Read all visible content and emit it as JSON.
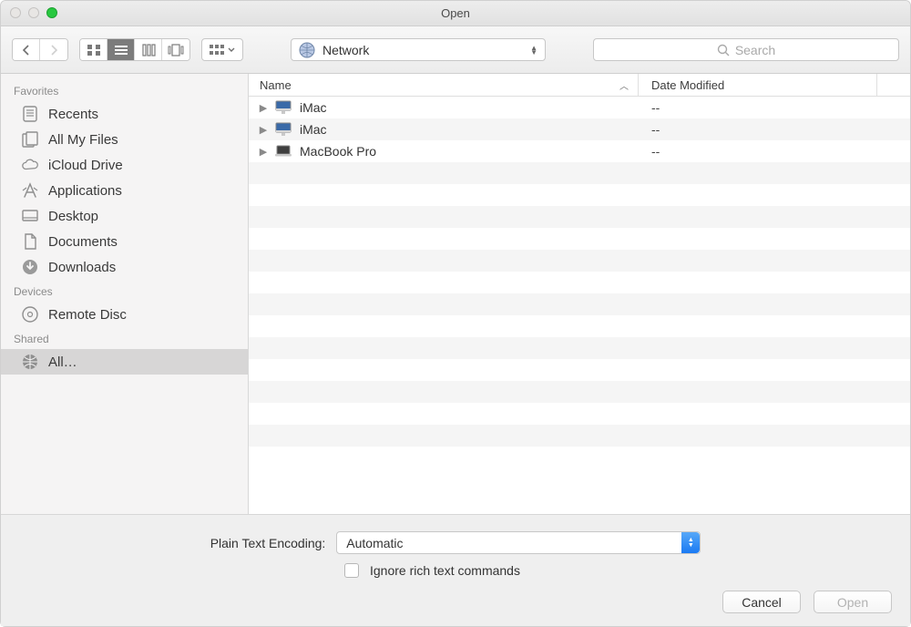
{
  "window": {
    "title": "Open"
  },
  "toolbar": {
    "location_label": "Network",
    "search_placeholder": "Search"
  },
  "sidebar": {
    "sections": [
      {
        "title": "Favorites",
        "items": [
          {
            "label": "Recents",
            "icon": "doc-list"
          },
          {
            "label": "All My Files",
            "icon": "doc-stack"
          },
          {
            "label": "iCloud Drive",
            "icon": "cloud"
          },
          {
            "label": "Applications",
            "icon": "app-a"
          },
          {
            "label": "Desktop",
            "icon": "desktop"
          },
          {
            "label": "Documents",
            "icon": "documents"
          },
          {
            "label": "Downloads",
            "icon": "download"
          }
        ]
      },
      {
        "title": "Devices",
        "items": [
          {
            "label": "Remote Disc",
            "icon": "disc"
          }
        ]
      },
      {
        "title": "Shared",
        "items": [
          {
            "label": "All…",
            "icon": "globe",
            "selected": true
          }
        ]
      }
    ]
  },
  "columns": {
    "name": "Name",
    "date": "Date Modified"
  },
  "items": [
    {
      "name": "iMac",
      "date": "--",
      "kind": "imac"
    },
    {
      "name": "iMac",
      "date": "--",
      "kind": "imac"
    },
    {
      "name": "MacBook Pro",
      "date": "--",
      "kind": "macbook"
    }
  ],
  "footer": {
    "encoding_label": "Plain Text Encoding:",
    "encoding_value": "Automatic",
    "ignore_label": "Ignore rich text commands",
    "cancel": "Cancel",
    "open": "Open"
  }
}
